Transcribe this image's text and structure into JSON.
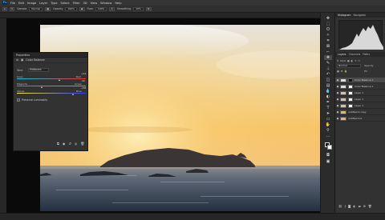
{
  "menu": {
    "logo": "Ps",
    "items": [
      "File",
      "Edit",
      "Image",
      "Layer",
      "Type",
      "Select",
      "Filter",
      "3D",
      "View",
      "Window",
      "Help"
    ]
  },
  "options": {
    "tool_label": "Sample",
    "sample_value": "Normal",
    "opacity_label": "Opacity",
    "opacity_value": "100%",
    "flow_label": "Flow",
    "flow_value": "100%",
    "smoothing_label": "Smoothing",
    "smoothing_value": "10%"
  },
  "properties": {
    "title": "Properties",
    "adjustment_name": "Color Balance",
    "tone_label": "Tone",
    "tone_value": "Midtones",
    "sliders": [
      {
        "left": "Cyan",
        "right": "Red",
        "value": "+14",
        "level": 0.62
      },
      {
        "left": "Magenta",
        "right": "Green",
        "value": "-12",
        "level": 0.37
      },
      {
        "left": "Yellow",
        "right": "Blue",
        "value": "+58",
        "level": 0.82
      }
    ],
    "preserve_label": "Preserve Luminosity",
    "preserve_checked": true
  },
  "panels": {
    "histogram_tab": "Histogram",
    "navigator_tab": "Navigator",
    "layers_tab": "Layers",
    "channels_tab": "Channels",
    "paths_tab": "Paths",
    "kind_label": "Kind",
    "blend_mode": "Normal",
    "opacity_label": "Opacity",
    "fill_label": "Fill",
    "layers": [
      {
        "name": "Color Balance 1",
        "selected": true
      },
      {
        "name": "Color Balance 1",
        "selected": false
      },
      {
        "name": "Layer 1",
        "selected": false
      },
      {
        "name": "Layer 1",
        "selected": false
      },
      {
        "name": "Layer 1",
        "selected": false
      },
      {
        "name": "untitled 4 copy",
        "selected": false
      },
      {
        "name": "untitled 4.0",
        "selected": false
      }
    ]
  },
  "colors": {
    "app_bg": "#323232",
    "sky_top": "#e8e4dc",
    "sky_warm": "#f6c86a",
    "sea": "#3d4b5e"
  }
}
